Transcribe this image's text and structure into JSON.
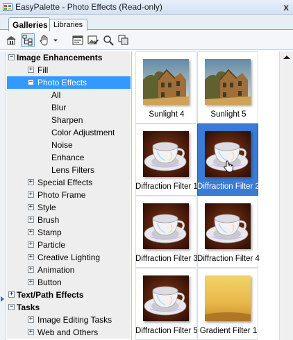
{
  "window": {
    "title": "EasyPalette - Photo Effects (Read-only)",
    "close_glyph": "x"
  },
  "tabs": [
    {
      "label": "Galleries"
    },
    {
      "label": "Libraries"
    }
  ],
  "toolbar": {
    "buttons": [
      {
        "icon": "home-icon"
      },
      {
        "icon": "tree-view-icon"
      },
      {
        "icon": "hand-tool-icon"
      },
      {
        "icon": "dropdown-arrow-icon"
      },
      {
        "icon": "properties-icon"
      },
      {
        "icon": "image-edit-icon"
      },
      {
        "icon": "search-icon"
      },
      {
        "icon": "copy-icon"
      }
    ]
  },
  "tree": {
    "items": [
      {
        "label": "Image Enhancements",
        "expander": "−",
        "level": 0,
        "bold": true,
        "shaded": true
      },
      {
        "label": "Fill",
        "expander": "+",
        "level": 1,
        "shaded": true
      },
      {
        "label": "Photo Effects",
        "expander": "−",
        "level": 1,
        "selected": true
      },
      {
        "label": "All",
        "level": 2,
        "shaded": true
      },
      {
        "label": "Blur",
        "level": 2,
        "shaded": true
      },
      {
        "label": "Sharpen",
        "level": 2,
        "shaded": true
      },
      {
        "label": "Color Adjustment",
        "level": 2,
        "shaded": true
      },
      {
        "label": "Noise",
        "level": 2,
        "shaded": true
      },
      {
        "label": "Enhance",
        "level": 2,
        "shaded": true
      },
      {
        "label": "Lens Filters",
        "level": 2,
        "shaded": true
      },
      {
        "label": "Special Effects",
        "expander": "+",
        "level": 1,
        "shaded": true
      },
      {
        "label": "Photo Frame",
        "expander": "+",
        "level": 1,
        "shaded": true
      },
      {
        "label": "Style",
        "expander": "+",
        "level": 1,
        "shaded": true
      },
      {
        "label": "Brush",
        "expander": "+",
        "level": 1,
        "shaded": true
      },
      {
        "label": "Stamp",
        "expander": "+",
        "level": 1,
        "shaded": true
      },
      {
        "label": "Particle",
        "expander": "+",
        "level": 1,
        "shaded": true
      },
      {
        "label": "Creative Lighting",
        "expander": "+",
        "level": 1,
        "shaded": true
      },
      {
        "label": "Animation",
        "expander": "+",
        "level": 1,
        "shaded": true
      },
      {
        "label": "Button",
        "expander": "+",
        "level": 1,
        "shaded": true
      },
      {
        "label": "Text/Path Effects",
        "expander": "+",
        "level": 0,
        "bold": true,
        "shaded": true
      },
      {
        "label": "Tasks",
        "expander": "−",
        "level": 0,
        "bold": true,
        "shaded": true
      },
      {
        "label": "Image Editing Tasks",
        "expander": "+",
        "level": 1,
        "shaded": true
      },
      {
        "label": "Web and Others",
        "expander": "+",
        "level": 1,
        "shaded": true
      }
    ]
  },
  "gallery": {
    "items": [
      {
        "caption": "Sunlight 4",
        "thumb": "house"
      },
      {
        "caption": "Sunlight 5",
        "thumb": "house"
      },
      {
        "caption": "Diffraction Filter 1",
        "thumb": "cup"
      },
      {
        "caption": "Diffraction Filter 2",
        "thumb": "cup",
        "selected": true
      },
      {
        "caption": "Diffraction Filter 3",
        "thumb": "cup"
      },
      {
        "caption": "Diffraction Filter 4",
        "thumb": "cup"
      },
      {
        "caption": "Diffraction Filter 5",
        "thumb": "cup"
      },
      {
        "caption": "Gradient Filter 1",
        "thumb": "gradient"
      }
    ]
  },
  "colors": {
    "selection": "#3399ff",
    "gallery_selection": "#3a7bd5"
  }
}
